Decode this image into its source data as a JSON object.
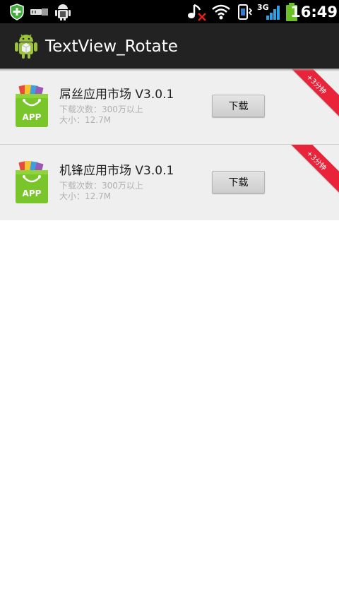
{
  "status_bar": {
    "time": "16:49",
    "network_label": "3G",
    "icons": [
      "security-shield-icon",
      "usb-icon",
      "android-debug-icon",
      "music-muted-icon",
      "wifi-icon",
      "vibrate-icon",
      "signal-icon",
      "battery-icon"
    ]
  },
  "action_bar": {
    "title": "TextView_Rotate",
    "icon": "android-app-icon"
  },
  "list": {
    "items": [
      {
        "title": "屌丝应用市场 V3.0.1",
        "downloads": "下载次数：300万以上",
        "size": "大小：12.7M",
        "button": "下载",
        "ribbon": "+3分钟",
        "logo_label": "APP"
      },
      {
        "title": "机锋应用市场 V3.0.1",
        "downloads": "下载次数：300万以上",
        "size": "大小：12.7M",
        "button": "下载",
        "ribbon": "+3分钟",
        "logo_label": "APP"
      }
    ]
  },
  "colors": {
    "status_bar": "#000000",
    "action_bar": "#222222",
    "list_background": "#efefef",
    "ribbon": "#e8233a",
    "app_logo_green": "#7ac52a"
  }
}
